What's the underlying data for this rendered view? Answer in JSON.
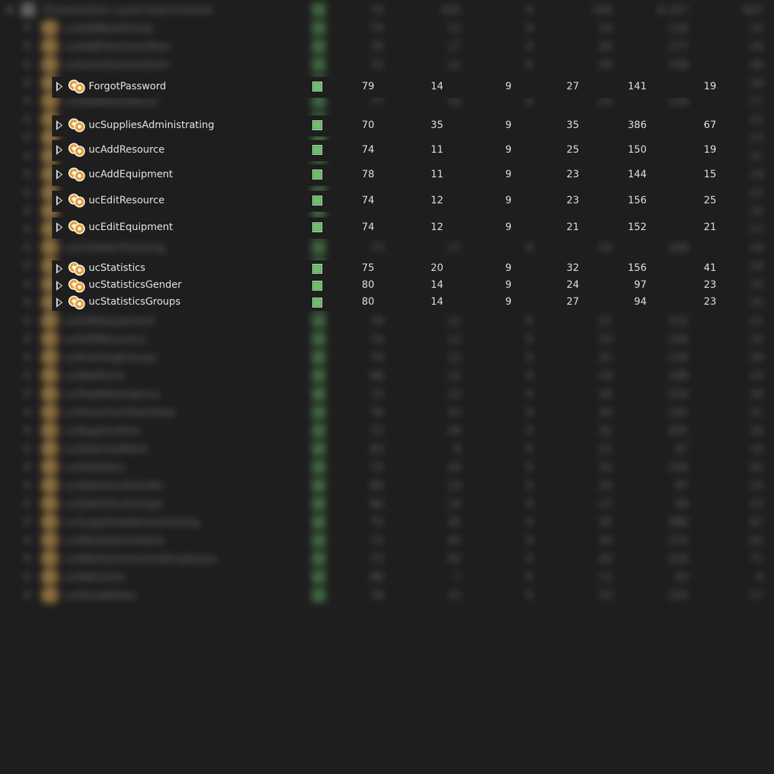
{
  "tree": {
    "root_label": "Presentation.Layer.UserControls",
    "root_values": [
      "74",
      "435",
      "9",
      "140",
      "6,107",
      "647"
    ],
    "rows": [
      {
        "name": "ForgotPassword",
        "mi": "79",
        "cc": "14",
        "doi": "9",
        "cbo": "27",
        "loc_source": "141",
        "loc_exec": "19"
      },
      {
        "name": "ucSuppliesAdministrating",
        "mi": "70",
        "cc": "35",
        "doi": "9",
        "cbo": "35",
        "loc_source": "386",
        "loc_exec": "67"
      },
      {
        "name": "ucAddResource",
        "mi": "74",
        "cc": "11",
        "doi": "9",
        "cbo": "25",
        "loc_source": "150",
        "loc_exec": "19"
      },
      {
        "name": "ucAddEquipment",
        "mi": "78",
        "cc": "11",
        "doi": "9",
        "cbo": "23",
        "loc_source": "144",
        "loc_exec": "15"
      },
      {
        "name": "ucEditResource",
        "mi": "74",
        "cc": "12",
        "doi": "9",
        "cbo": "23",
        "loc_source": "156",
        "loc_exec": "25"
      },
      {
        "name": "ucEditEquipment",
        "mi": "74",
        "cc": "12",
        "doi": "9",
        "cbo": "21",
        "loc_source": "152",
        "loc_exec": "21"
      },
      {
        "name": "ucStatistics",
        "mi": "75",
        "cc": "20",
        "doi": "9",
        "cbo": "32",
        "loc_source": "156",
        "loc_exec": "41"
      },
      {
        "name": "ucStatisticsGender",
        "mi": "80",
        "cc": "14",
        "doi": "9",
        "cbo": "24",
        "loc_source": "97",
        "loc_exec": "23"
      },
      {
        "name": "ucStatisticsGroups",
        "mi": "80",
        "cc": "14",
        "doi": "9",
        "cbo": "27",
        "loc_source": "94",
        "loc_exec": "23"
      }
    ],
    "background_rows": [
      {
        "name": "ucAddNewGroup",
        "v": [
          "75",
          "12",
          "9",
          "19",
          "118",
          "15"
        ]
      },
      {
        "name": "ucAddPreschoolYear",
        "v": [
          "76",
          "17",
          "9",
          "20",
          "177",
          "24"
        ]
      },
      {
        "name": "ucActivityScheduler",
        "v": [
          "72",
          "12",
          "9",
          "29",
          "158",
          "26"
        ]
      },
      {
        "name": "",
        "v": [
          "",
          "",
          "",
          "",
          "",
          "29"
        ]
      },
      {
        "name": "ucAddAttendance",
        "v": [
          "77",
          "16",
          "9",
          "24",
          "130",
          "17"
        ]
      },
      {
        "name": "",
        "v": [
          "",
          "",
          "",
          "",
          "",
          "22"
        ]
      },
      {
        "name": "",
        "v": [
          "",
          "",
          "",
          "",
          "",
          "23"
        ]
      },
      {
        "name": "",
        "v": [
          "",
          "",
          "",
          "",
          "",
          "21"
        ]
      },
      {
        "name": "",
        "v": [
          "",
          "",
          "",
          "",
          "",
          "19"
        ]
      },
      {
        "name": "",
        "v": [
          "",
          "",
          "",
          "",
          "",
          "22"
        ]
      },
      {
        "name": "",
        "v": [
          "",
          "",
          "",
          "",
          "",
          "25"
        ]
      },
      {
        "name": "",
        "v": [
          "",
          "",
          "",
          "",
          "",
          "27"
        ]
      },
      {
        "name": "ucChildrenTracking",
        "v": [
          "73",
          "27",
          "9",
          "33",
          "249",
          "34"
        ]
      },
      {
        "name": "",
        "v": [
          "",
          "",
          "",
          "",
          "",
          "24"
        ]
      },
      {
        "name": "",
        "v": [
          "",
          "",
          "",
          "",
          "",
          "33"
        ]
      },
      {
        "name": "",
        "v": [
          "",
          "",
          "",
          "",
          "",
          "33"
        ]
      },
      {
        "name": "ucEditEquipment",
        "v": [
          "74",
          "12",
          "9",
          "21",
          "152",
          "21"
        ]
      },
      {
        "name": "ucEditResource",
        "v": [
          "74",
          "12",
          "9",
          "23",
          "156",
          "25"
        ]
      },
      {
        "name": "ucExistingGroups",
        "v": [
          "79",
          "12",
          "9",
          "21",
          "128",
          "16"
        ]
      },
      {
        "name": "ucMailForm",
        "v": [
          "68",
          "22",
          "9",
          "29",
          "188",
          "33"
        ]
      },
      {
        "name": "ucPaidAttendance",
        "v": [
          "73",
          "23",
          "9",
          "34",
          "220",
          "34"
        ]
      },
      {
        "name": "ucPreschoolYearView",
        "v": [
          "76",
          "15",
          "9",
          "26",
          "142",
          "21"
        ]
      },
      {
        "name": "ucRegistration",
        "v": [
          "72",
          "29",
          "9",
          "32",
          "265",
          "34"
        ]
      },
      {
        "name": "ucSelectedNote",
        "v": [
          "83",
          "8",
          "9",
          "21",
          "67",
          "10"
        ]
      },
      {
        "name": "ucStatistics",
        "v": [
          "75",
          "20",
          "9",
          "32",
          "156",
          "41"
        ]
      },
      {
        "name": "ucStatisticsGender",
        "v": [
          "80",
          "14",
          "9",
          "24",
          "97",
          "23"
        ]
      },
      {
        "name": "ucStatisticsGroups",
        "v": [
          "80",
          "14",
          "9",
          "27",
          "94",
          "23"
        ]
      },
      {
        "name": "ucSuppliesAdministrating",
        "v": [
          "70",
          "35",
          "9",
          "35",
          "386",
          "67"
        ]
      },
      {
        "name": "ucWeeklySchedule",
        "v": [
          "73",
          "43",
          "9",
          "34",
          "275",
          "61"
        ]
      },
      {
        "name": "ucWeeklyScheduleEmployee",
        "v": [
          "73",
          "50",
          "9",
          "43",
          "329",
          "71"
        ]
      },
      {
        "name": "ucWelcome",
        "v": [
          "88",
          "7",
          "9",
          "11",
          "43",
          "6"
        ]
      },
      {
        "name": "ucShowNotes",
        "v": [
          "78",
          "15",
          "9",
          "23",
          "155",
          "17"
        ]
      }
    ]
  },
  "colors": {
    "background": "#1e1e1e",
    "text": "#e0e0e0",
    "status_green": "#6cc06c",
    "uc_icon": "#e0a040"
  },
  "icons": {
    "expand": "triangle-right-outline-icon",
    "user_control": "user-control-gears-icon",
    "status": "green-square-icon"
  }
}
